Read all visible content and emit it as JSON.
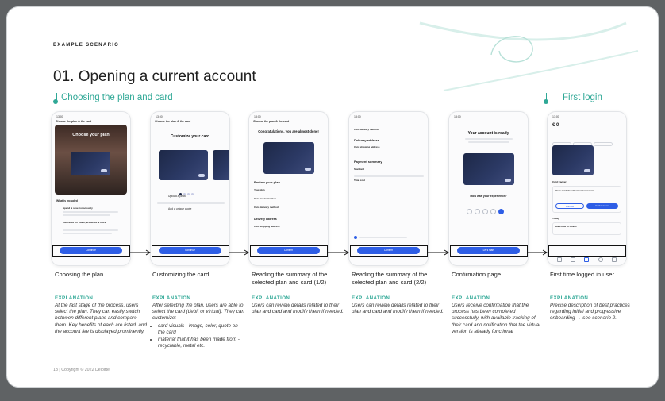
{
  "header": {
    "scenario_label": "EXAMPLE SCENARIO",
    "title": "01. Opening a current account"
  },
  "sections": {
    "left": "Choosing the plan and card",
    "right": "First login"
  },
  "screens": [
    {
      "caption": "Choosing the plan",
      "explanation_heading": "EXPLANATION",
      "explanation": "At the last stage of the process, users select the plan. They can easily switch between different plans and compare them. Key benefits of each are listed, and the account fee is displayed prominently.",
      "phone": {
        "status": "13:00",
        "header": "Choose the plan & the card",
        "hero_title": "Choose your plan",
        "section": "What is included",
        "item1": "Spend & save consciously",
        "item2": "Insurance for travel, accidents & more",
        "button": "Continue"
      }
    },
    {
      "caption": "Customizing the card",
      "explanation_heading": "EXPLANATION",
      "explanation": "After selecting the plan, users are able to select the card (debit or virtual). They can customize:",
      "bullets": [
        "card visuals - image, color, quote on the card",
        "material that it has been made from - recyclable, metal etc."
      ],
      "phone": {
        "status": "13:00",
        "header": "Choose the plan & the card",
        "title": "Customize your card",
        "option1": "Upload a photo",
        "option2": "Add a unique quote",
        "button": "Continue"
      }
    },
    {
      "caption": "Reading the summary of the selected plan and card (1/2)",
      "explanation_heading": "EXPLANATION",
      "explanation": "Users can review details related to their plan and card and modify them if needed.",
      "phone": {
        "status": "13:00",
        "header": "Choose the plan & the card",
        "title": "Congratulations, you are almost done!",
        "section": "Review your plan",
        "row1": "Your plan",
        "row2": "Card customization",
        "row3": "Card delivery method",
        "section2": "Delivery address",
        "row4": "Card shipping address",
        "button": "Confirm"
      }
    },
    {
      "caption": "Reading the summary of the selected plan and card (2/2)",
      "explanation_heading": "EXPLANATION",
      "explanation": "Users can review details related to their plan and card and modify them if needed.",
      "phone": {
        "status": "13:00",
        "row1": "Card delivery method",
        "section": "Delivery address",
        "row2": "Card shipping address",
        "section2": "Payment summary",
        "row3": "Standard",
        "row4": "Total cost",
        "button": "Confirm"
      }
    },
    {
      "caption": "Confirmation page",
      "explanation_heading": "EXPLANATION",
      "explanation": "Users receive confirmation that the process has been completed successfully, with available tracking of their card and notification that the virtual version is already functional",
      "phone": {
        "status": "13:00",
        "title": "Your account is ready",
        "question": "How was your experience?",
        "button": "Let's start"
      }
    },
    {
      "caption": "First time logged in user",
      "explanation_heading": "EXPLANATION",
      "explanation": "Precise description of best practices regarding initial and progressive onboarding → see scenario 2.",
      "phone": {
        "status": "13:00",
        "balance": "€ 0",
        "section": "Card tracker",
        "tracker": "Your card should arrive tomorrow!",
        "btn_secondary": "Dismiss",
        "btn_primary": "Card received",
        "today": "Today",
        "welcome": "Welcome to Olivio!"
      }
    }
  ],
  "footer": "13 | Copyright © 2022 Deloitte.",
  "colors": {
    "accent": "#2fa896",
    "primary_button": "#2e5ee6",
    "card": "#1d2847"
  }
}
